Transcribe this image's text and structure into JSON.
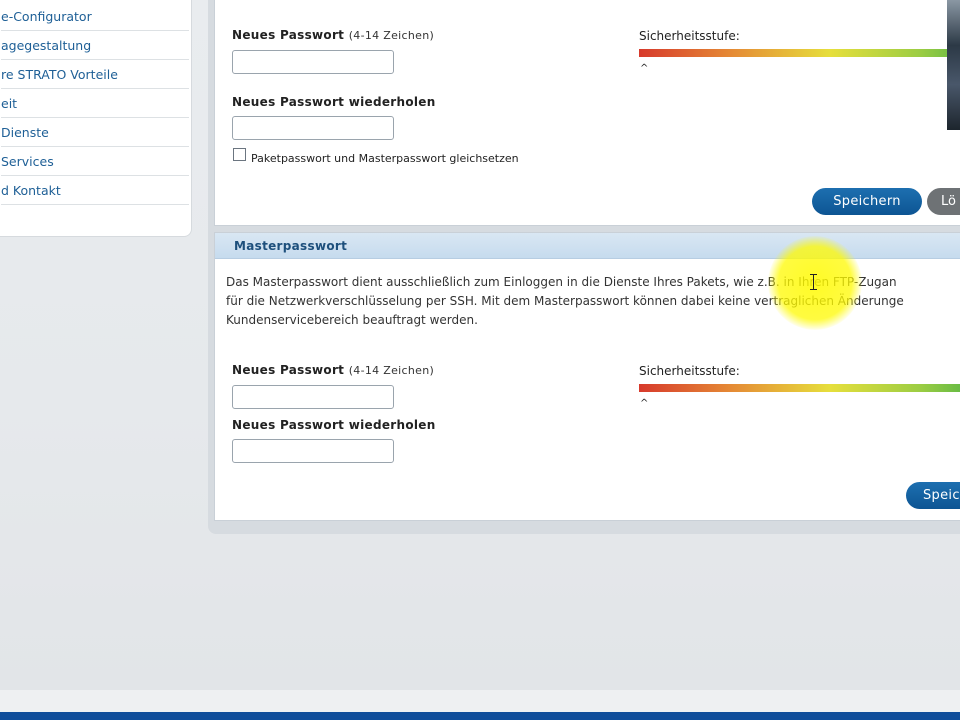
{
  "sidebar": {
    "items": [
      {
        "label": "e-Configurator"
      },
      {
        "label": "agegestaltung"
      },
      {
        "label": "re STRATO Vorteile"
      },
      {
        "label": "eit"
      },
      {
        "label": "Dienste"
      },
      {
        "label": "Services"
      },
      {
        "label": "d Kontakt"
      }
    ]
  },
  "package_password": {
    "new_label": "Neues Passwort",
    "new_hint": "(4-14 Zeichen)",
    "repeat_label": "Neues Passwort wiederholen",
    "strength_label": "Sicherheitsstufe:",
    "strength_marker": "^",
    "checkbox_label": "Paketpasswort und Masterpasswort gleichsetzen",
    "save_label": "Speichern",
    "delete_label": "Lö"
  },
  "master_password": {
    "title": "Masterpasswort",
    "desc_line1": "Das Masterpasswort dient ausschließlich zum Einloggen in die Dienste Ihres Pakets, wie z.B. in Ihren FTP-Zugan",
    "desc_line2": "für die Netzwerkverschlüsselung per SSH. Mit dem Masterpasswort können dabei keine vertraglichen Änderunge",
    "desc_line3": "Kundenservicebereich beauftragt werden.",
    "new_label": "Neues Passwort",
    "new_hint": "(4-14 Zeichen)",
    "repeat_label": "Neues Passwort wiederholen",
    "strength_label": "Sicherheitsstufe:",
    "strength_marker": "^",
    "save_label": "Speic"
  },
  "colors": {
    "accent": "#0d5593",
    "section_header": "#c6dbee",
    "link": "#1e5f96",
    "footer": "#0f4d9a"
  }
}
